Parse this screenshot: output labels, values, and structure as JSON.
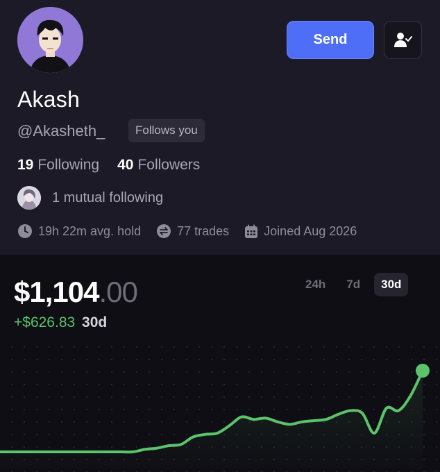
{
  "profile": {
    "name": "Akash",
    "handle": "@Akasheth_",
    "follows_badge": "Follows you",
    "following_count": "19",
    "following_label": "Following",
    "followers_count": "40",
    "followers_label": "Followers",
    "mutual_text": "1 mutual following",
    "avg_hold": "19h 22m avg. hold",
    "trades": "77 trades",
    "joined": "Joined Aug 2026"
  },
  "actions": {
    "send_label": "Send",
    "follow_icon": "user-check-icon"
  },
  "portfolio": {
    "balance_whole": "$1,104",
    "balance_cents": ".00",
    "change": "+$626.83",
    "change_period": "30d",
    "ranges": [
      "24h",
      "7d",
      "30d"
    ],
    "active_range": "30d"
  },
  "colors": {
    "accent": "#4f6ef7",
    "positive": "#5bc46b",
    "background": "#1c1a26",
    "chart_background": "#0f0e14"
  },
  "chart_data": {
    "type": "line",
    "series": [
      {
        "values": [
          0,
          0,
          0,
          0,
          0,
          0,
          0,
          0,
          0,
          0,
          0,
          0,
          20,
          30,
          50,
          60,
          120,
          140,
          150,
          210,
          280,
          260,
          270,
          240,
          220,
          240,
          250,
          260,
          300,
          330,
          310,
          150,
          350,
          330,
          450,
          650
        ]
      }
    ],
    "ylim": [
      0,
      700
    ],
    "grid": false,
    "legend": "none"
  }
}
